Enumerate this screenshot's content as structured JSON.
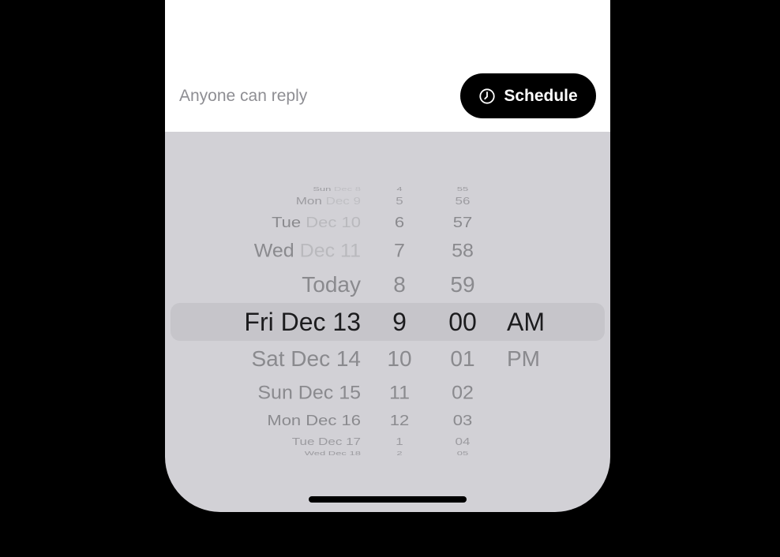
{
  "compose": {
    "reply_setting": "Anyone can reply",
    "schedule_button": {
      "label": "Schedule",
      "icon": "clock-icon"
    }
  },
  "picker": {
    "dates": [
      {
        "day": "Sun",
        "date": "Dec 8"
      },
      {
        "day": "Mon",
        "date": "Dec 9"
      },
      {
        "day": "Tue",
        "date": "Dec 10"
      },
      {
        "day": "Wed",
        "date": "Dec 11"
      },
      {
        "day": "Today",
        "date": ""
      },
      {
        "day": "Fri",
        "date": "Dec 13"
      },
      {
        "day": "Sat",
        "date": "Dec 14"
      },
      {
        "day": "Sun",
        "date": "Dec 15"
      },
      {
        "day": "Mon",
        "date": "Dec 16"
      },
      {
        "day": "Tue",
        "date": "Dec 17"
      },
      {
        "day": "Wed",
        "date": "Dec 18"
      }
    ],
    "hours": [
      "4",
      "5",
      "6",
      "7",
      "8",
      "9",
      "10",
      "11",
      "12",
      "1",
      "2"
    ],
    "minutes": [
      "55",
      "56",
      "57",
      "58",
      "59",
      "00",
      "01",
      "02",
      "03",
      "04",
      "05"
    ],
    "ampm": [
      "AM",
      "PM"
    ],
    "selected": {
      "date": "Fri Dec 13",
      "hour": "9",
      "minute": "00",
      "ampm": "AM"
    }
  }
}
